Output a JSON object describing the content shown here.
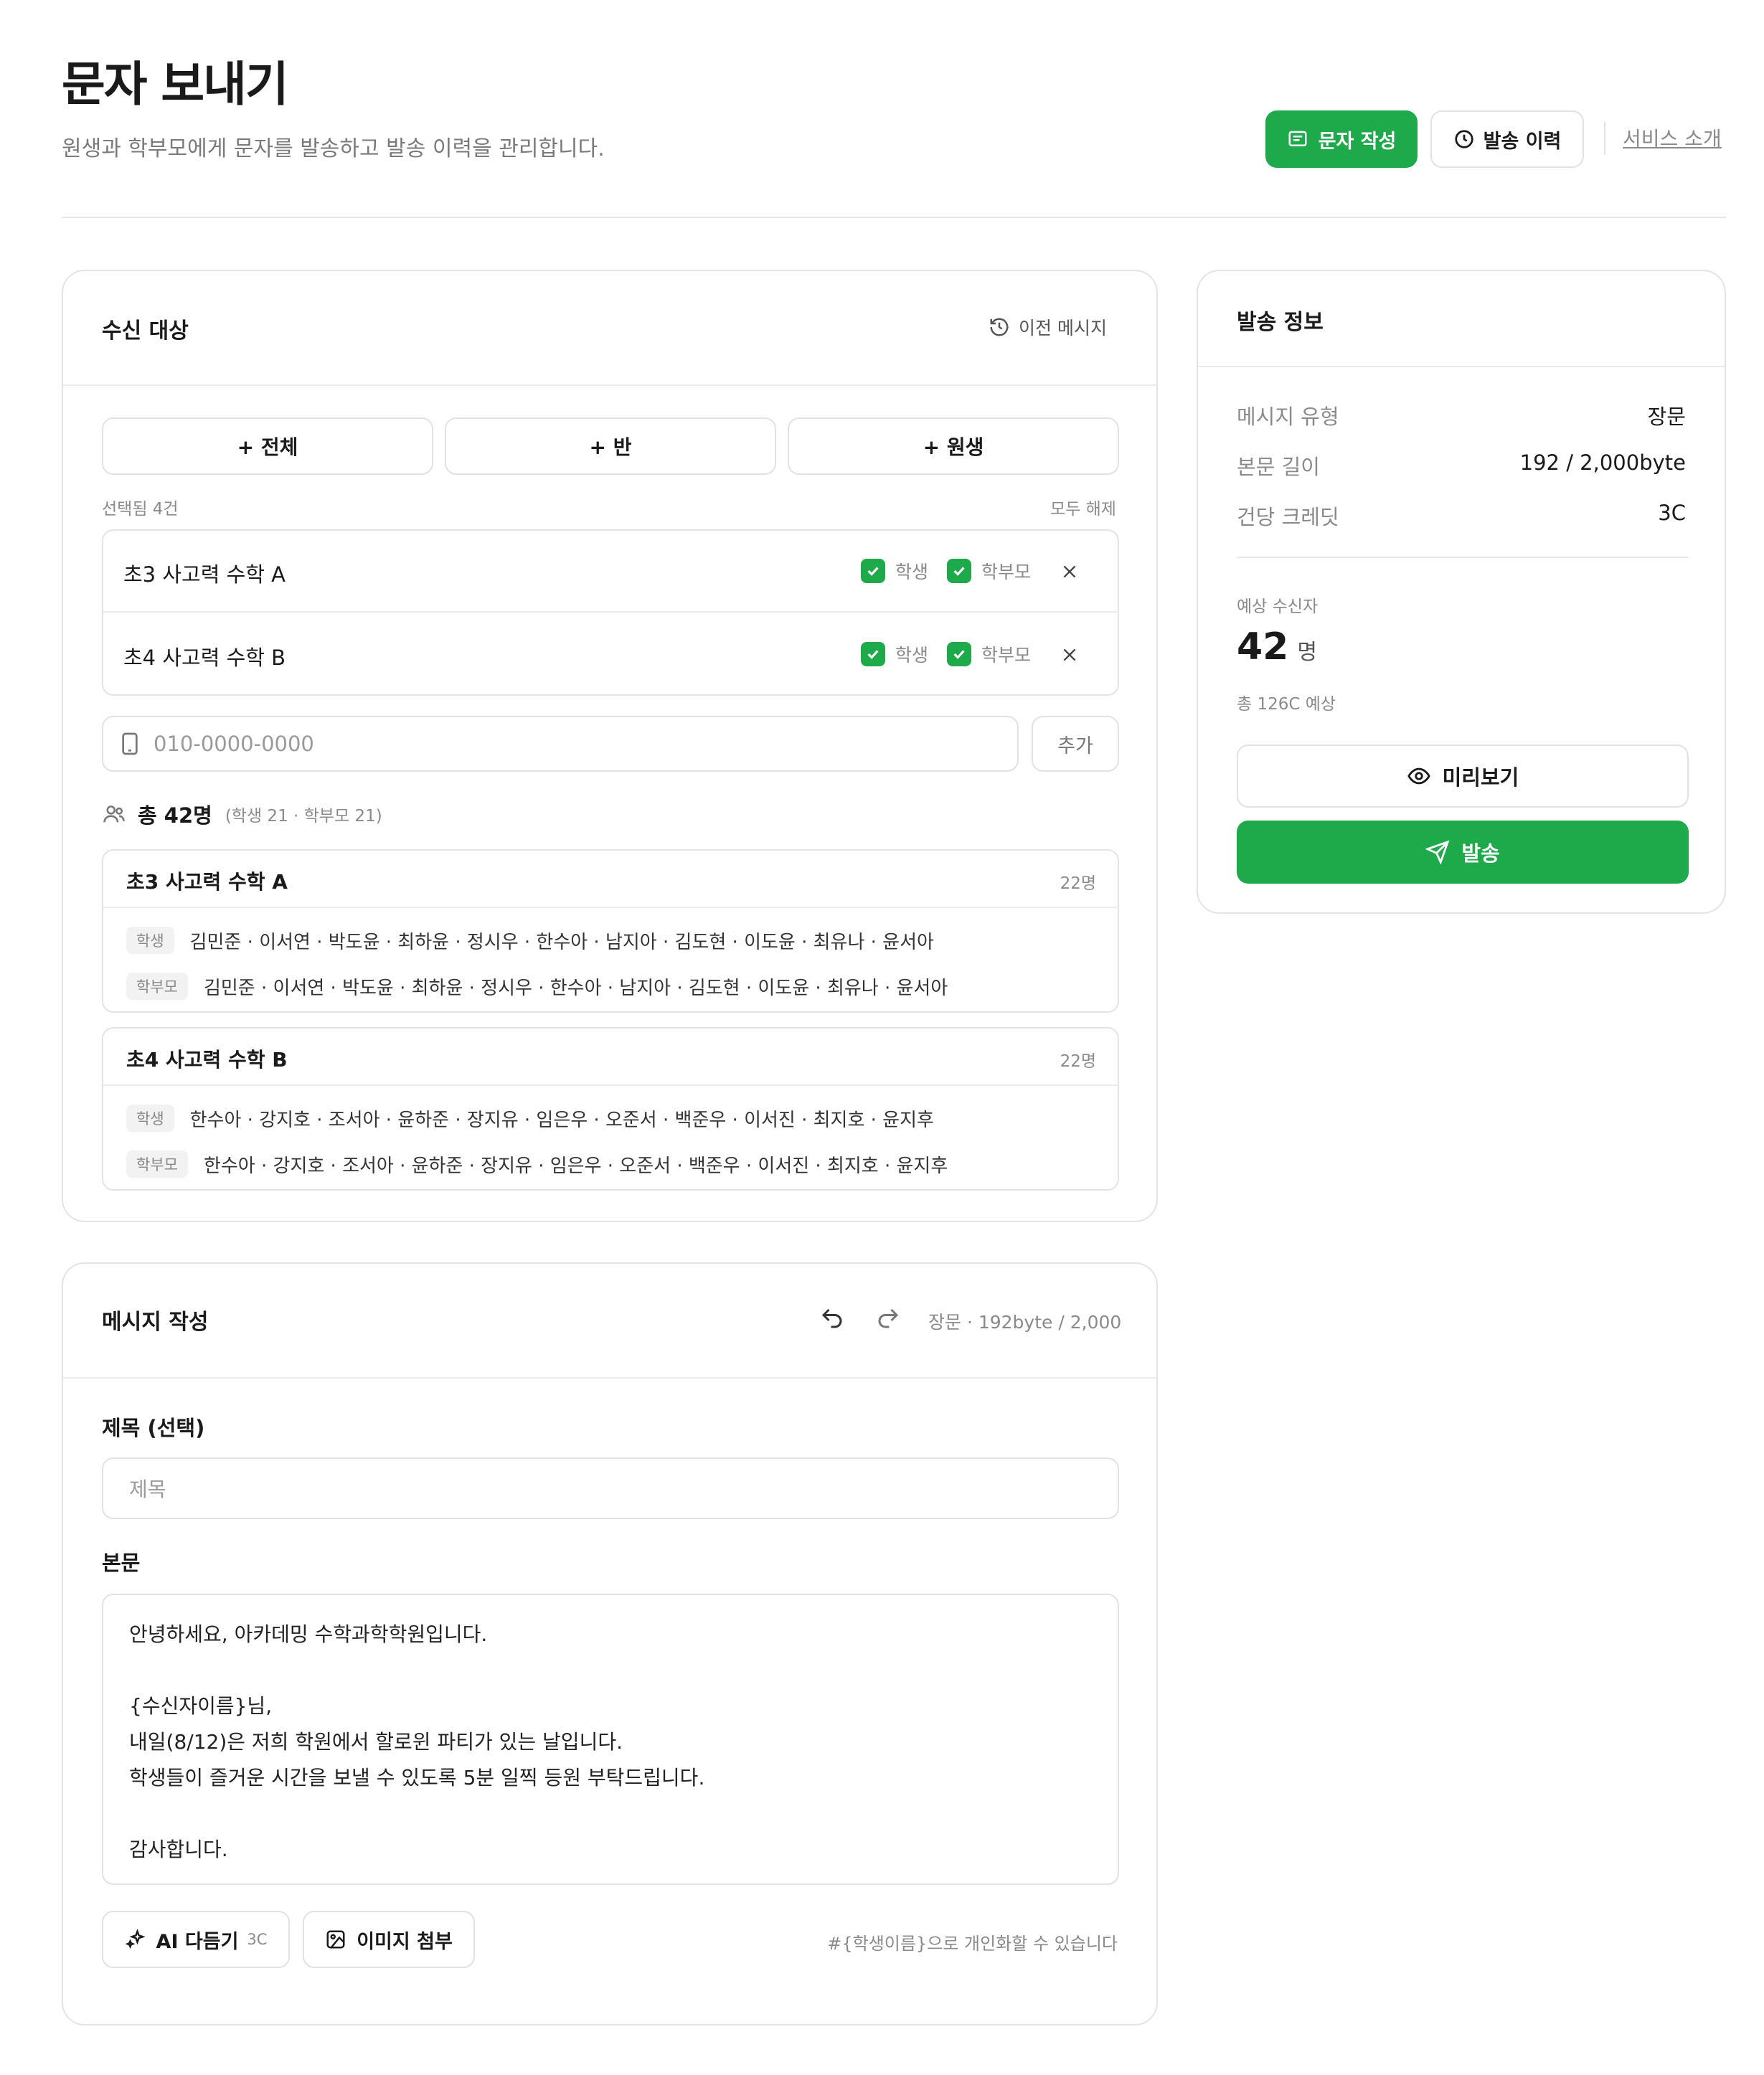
{
  "header": {
    "title": "문자 보내기",
    "subtitle": "원생과 학부모에게 문자를 발송하고 발송 이력을 관리합니다.",
    "compose_label": "문자 작성",
    "history_label": "발송 이력",
    "intro_label": "서비스 소개"
  },
  "recipients": {
    "title": "수신 대상",
    "prev_label": "이전 메시지",
    "add_all": "+ 전체",
    "add_class": "+ 반",
    "add_student": "+ 원생",
    "selected_label": "선택됨 4건",
    "clear_label": "모두 해제",
    "selected": [
      {
        "name": "초3 사고력 수학 A",
        "student": "학생",
        "parent": "학부모"
      },
      {
        "name": "초4 사고력 수학 B",
        "student": "학생",
        "parent": "학부모"
      }
    ],
    "phone_placeholder": "010-0000-0000",
    "add_phone": "추가",
    "total_label": "총 42명",
    "total_detail": "(학생 21 · 학부모 21)",
    "groups": [
      {
        "name": "초3 사고력 수학 A",
        "count": "22명",
        "rows": [
          {
            "tag": "학생",
            "names": "김민준 · 이서연 · 박도윤 · 최하윤 · 정시우 · 한수아 · 남지아 · 김도현 · 이도윤 · 최유나 · 윤서아"
          },
          {
            "tag": "학부모",
            "names": "김민준 · 이서연 · 박도윤 · 최하윤 · 정시우 · 한수아 · 남지아 · 김도현 · 이도윤 · 최유나 · 윤서아"
          }
        ]
      },
      {
        "name": "초4 사고력 수학 B",
        "count": "22명",
        "rows": [
          {
            "tag": "학생",
            "names": "한수아 · 강지호 · 조서아 · 윤하준 · 장지유 · 임은우 · 오준서 · 백준우 · 이서진 · 최지호 · 윤지후"
          },
          {
            "tag": "학부모",
            "names": "한수아 · 강지호 · 조서아 · 윤하준 · 장지유 · 임은우 · 오준서 · 백준우 · 이서진 · 최지호 · 윤지후"
          }
        ]
      }
    ]
  },
  "compose": {
    "title": "메시지 작성",
    "meta": "장문 · 192byte / 2,000",
    "subject_label": "제목 (선택)",
    "subject_placeholder": "제목",
    "body_label": "본문",
    "body_lines": [
      "안녕하세요, 아카데밍 수학과학학원입니다.",
      "",
      "{수신자이름}님,",
      "내일(8/12)은 저희 학원에서 할로윈 파티가 있는 날입니다.",
      "학생들이 즐거운 시간을 보낼 수 있도록 5분 일찍 등원 부탁드립니다.",
      "",
      "감사합니다."
    ],
    "ai_label": "AI 다듬기",
    "ai_cost": "3C",
    "image_label": "이미지 첨부",
    "hint": "#{학생이름}으로 개인화할 수 있습니다"
  },
  "send_info": {
    "title": "발송 정보",
    "rows": [
      {
        "label": "메시지 유형",
        "value": "장문"
      },
      {
        "label": "본문 길이",
        "value": "192 / 2,000byte"
      },
      {
        "label": "건당 크레딧",
        "value": "3C"
      }
    ],
    "expected_label": "예상 수신자",
    "expected_count": "42",
    "expected_unit": "명",
    "expected_credit": "총 126C 예상",
    "preview_label": "미리보기",
    "send_label": "발송"
  },
  "colors": {
    "accent": "#1ea94b",
    "text": "#1a1a1a",
    "muted": "#8a8a8a",
    "border": "#e4e4e4"
  },
  "icons": [
    "message-icon",
    "clock-icon",
    "history-icon",
    "check-icon",
    "close-icon",
    "phone-icon",
    "users-icon",
    "undo-icon",
    "redo-icon",
    "sparkle-icon",
    "image-icon",
    "eye-icon",
    "send-icon"
  ]
}
